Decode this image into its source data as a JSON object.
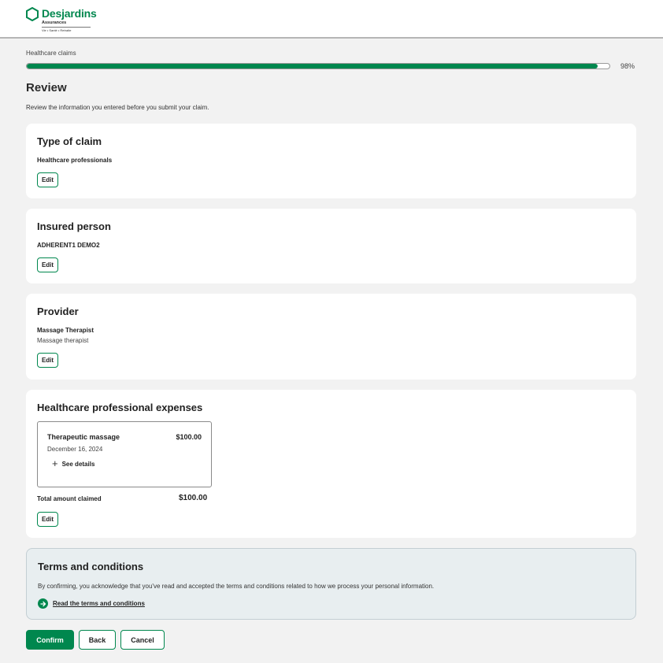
{
  "brand": {
    "name": "Desjardins",
    "subtitle": "Assurances",
    "tagline": "Vie • Santé • Retraite",
    "color": "#00874e"
  },
  "progress": {
    "label": "Healthcare claims",
    "percent": 98,
    "percent_label": "98%"
  },
  "page": {
    "title": "Review",
    "description": "Review the information you entered before you submit your claim."
  },
  "sections": {
    "claim_type": {
      "title": "Type of claim",
      "value": "Healthcare professionals",
      "edit_label": "Edit"
    },
    "insured": {
      "title": "Insured person",
      "value": "ADHERENT1 DEMO2",
      "edit_label": "Edit"
    },
    "provider": {
      "title": "Provider",
      "name": "Massage Therapist",
      "type": "Massage therapist",
      "edit_label": "Edit"
    },
    "expenses": {
      "title": "Healthcare professional expenses",
      "items": [
        {
          "name": "Therapeutic massage",
          "amount": "$100.00",
          "date": "December 16, 2024",
          "details_label": "See details"
        }
      ],
      "total_label": "Total amount claimed",
      "total_amount": "$100.00",
      "edit_label": "Edit"
    }
  },
  "terms": {
    "title": "Terms and conditions",
    "text": "By confirming, you acknowledge that you've read and accepted the terms and conditions related to how we process your personal information.",
    "link_label": "Read the terms and conditions"
  },
  "actions": {
    "confirm": "Confirm",
    "back": "Back",
    "cancel": "Cancel"
  },
  "icons": {
    "logo": "desjardins-hexagon-icon",
    "plus": "plus-icon",
    "arrow": "arrow-right-circle-icon"
  }
}
